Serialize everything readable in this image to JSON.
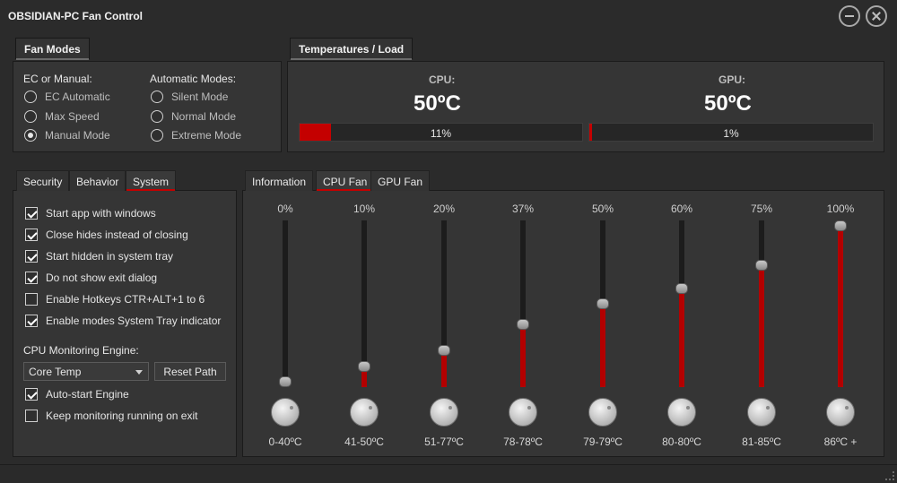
{
  "window": {
    "title": "OBSIDIAN-PC Fan Control"
  },
  "fan_modes": {
    "section_title": "Fan Modes",
    "ec_label": "EC or Manual:",
    "auto_label": "Automatic Modes:",
    "ec_options": [
      {
        "label": "EC Automatic",
        "selected": false
      },
      {
        "label": "Max Speed",
        "selected": false
      },
      {
        "label": "Manual Mode",
        "selected": true
      }
    ],
    "auto_options": [
      {
        "label": "Silent Mode",
        "selected": false
      },
      {
        "label": "Normal Mode",
        "selected": false
      },
      {
        "label": "Extreme Mode",
        "selected": false
      }
    ]
  },
  "temps": {
    "section_title": "Temperatures / Load",
    "cpu": {
      "label": "CPU:",
      "temp": "50ºC",
      "load_text": "11%",
      "load": 0.11
    },
    "gpu": {
      "label": "GPU:",
      "temp": "50ºC",
      "load_text": "1%",
      "load": 0.01
    },
    "bar_color": "#c40000"
  },
  "left_tabs": {
    "items": [
      "Security",
      "Behavior",
      "System"
    ],
    "active": "System"
  },
  "system": {
    "checks": [
      {
        "label": "Start app with windows",
        "checked": true
      },
      {
        "label": "Close hides instead of closing",
        "checked": true
      },
      {
        "label": "Start hidden in system tray",
        "checked": true
      },
      {
        "label": "Do not show exit dialog",
        "checked": true
      },
      {
        "label": "Enable Hotkeys CTR+ALT+1 to 6",
        "checked": false
      },
      {
        "label": "Enable modes System Tray indicator",
        "checked": true
      }
    ],
    "engine_label": "CPU Monitoring Engine:",
    "engine_value": "Core Temp",
    "reset_button": "Reset Path",
    "engine_checks": [
      {
        "label": "Auto-start Engine",
        "checked": true
      },
      {
        "label": "Keep monitoring running on exit",
        "checked": false
      }
    ]
  },
  "right_tabs": {
    "items": [
      "Information",
      "CPU Fan",
      "GPU Fan"
    ],
    "active": "CPU Fan"
  },
  "fan_curve": {
    "accent": "#b30000",
    "points": [
      {
        "pct": "0%",
        "value": 0,
        "range": "0-40ºC"
      },
      {
        "pct": "10%",
        "value": 10,
        "range": "41-50ºC"
      },
      {
        "pct": "20%",
        "value": 20,
        "range": "51-77ºC"
      },
      {
        "pct": "37%",
        "value": 37,
        "range": "78-78ºC"
      },
      {
        "pct": "50%",
        "value": 50,
        "range": "79-79ºC"
      },
      {
        "pct": "60%",
        "value": 60,
        "range": "80-80ºC"
      },
      {
        "pct": "75%",
        "value": 75,
        "range": "81-85ºC"
      },
      {
        "pct": "100%",
        "value": 100,
        "range": "86ºC +"
      }
    ]
  }
}
